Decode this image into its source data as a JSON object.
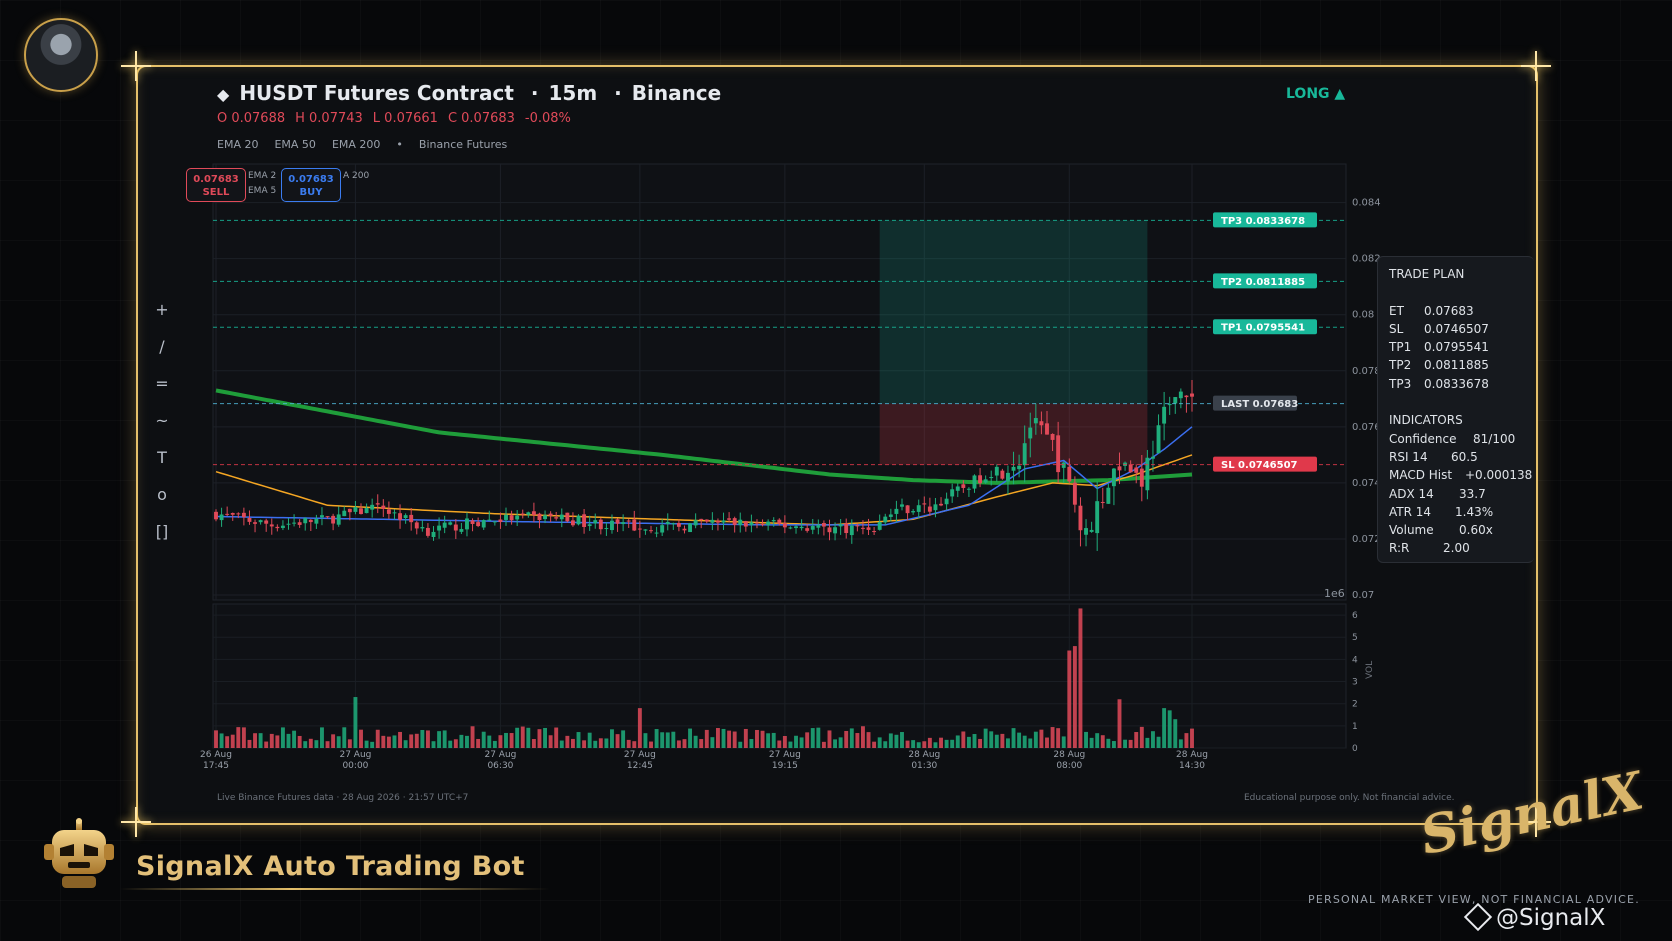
{
  "header": {
    "title": "HUSDT Futures Contract",
    "timeframe": "15m",
    "exchange": "Binance",
    "separator": "·",
    "direction": "LONG ▲"
  },
  "ohlc": {
    "o": "O 0.07688",
    "h": "H 0.07743",
    "l": "L 0.07661",
    "c": "C 0.07683",
    "change": "-0.08%"
  },
  "legend": {
    "ema20": "EMA 20",
    "ema50": "EMA 50",
    "ema200": "EMA 200",
    "dot": "•",
    "source": "Binance Futures"
  },
  "mini_legend": {
    "a": "EMA 2",
    "b": "EMA 5",
    "c": "A 200"
  },
  "sell_box": {
    "price": "0.07683",
    "label": "SELL"
  },
  "buy_box": {
    "price": "0.07683",
    "label": "BUY"
  },
  "tools": [
    "+",
    "/",
    "=",
    "~",
    "T",
    "o",
    "[]"
  ],
  "trade_panel": {
    "title": "TRADE PLAN",
    "rows": [
      {
        "k": "ET",
        "v": "0.07683"
      },
      {
        "k": "SL",
        "v": "0.0746507"
      },
      {
        "k": "TP1",
        "v": "0.0795541"
      },
      {
        "k": "TP2",
        "v": "0.0811885"
      },
      {
        "k": "TP3",
        "v": "0.0833678"
      }
    ],
    "indicators_title": "INDICATORS",
    "indicators": [
      {
        "k": "Confidence",
        "v": "81/100"
      },
      {
        "k": "RSI 14",
        "v": "60.5"
      },
      {
        "k": "MACD Hist",
        "v": "+0.000138"
      },
      {
        "k": "ADX 14",
        "v": "33.7"
      },
      {
        "k": "ATR 14",
        "v": "1.43%"
      },
      {
        "k": "Volume",
        "v": "0.60x"
      },
      {
        "k": "R:R",
        "v": "2.00"
      }
    ]
  },
  "footer": {
    "left": "Live Binance Futures data  ·  28 Aug 2026 · 21:57 UTC+7",
    "right": "Educational purpose only. Not financial advice."
  },
  "branding": {
    "bot_title": "SignalX Auto Trading Bot",
    "logo": "SignalX",
    "tagline": "PERSONAL MARKET VIEW, NOT FINANCIAL ADVICE.",
    "handle": "@SignalX"
  },
  "colors": {
    "up": "#1fae7c",
    "down": "#e04a59",
    "ema20": "#3b6ff0",
    "ema50": "#f5a623",
    "ema200": "#1f9d3a",
    "tp": "#18b89a",
    "sl": "#e0394b",
    "last": "#4fb6d8",
    "frame": "#e5c06a"
  },
  "chart_data": {
    "type": "candlestick",
    "price_axis": {
      "ticks": [
        "0.07",
        "0.072",
        "0.074",
        "0.076",
        "0.078",
        "0.08",
        "0.082",
        "0.084"
      ],
      "ylim": [
        0.07,
        0.0852
      ],
      "exponent_label": "1e6"
    },
    "volume_axis": {
      "ticks": [
        "0",
        "1",
        "2",
        "3",
        "4",
        "5",
        "6"
      ],
      "label": "VOL",
      "ylim": [
        0,
        6.5
      ]
    },
    "x_ticks": [
      {
        "label": "26 Aug\n17:45",
        "i": 0
      },
      {
        "label": "27 Aug\n00:00",
        "i": 25
      },
      {
        "label": "27 Aug\n06:30",
        "i": 51
      },
      {
        "label": "27 Aug\n12:45",
        "i": 76
      },
      {
        "label": "27 Aug\n19:15",
        "i": 102
      },
      {
        "label": "28 Aug\n01:30",
        "i": 127
      },
      {
        "label": "28 Aug\n08:00",
        "i": 153
      },
      {
        "label": "28 Aug\n14:30",
        "i": 175
      }
    ],
    "levels": [
      {
        "name": "TP3",
        "label": "TP3  0.0833678",
        "value": 0.0833678
      },
      {
        "name": "TP2",
        "label": "TP2  0.0811885",
        "value": 0.0811885
      },
      {
        "name": "TP1",
        "label": "TP1  0.0795541",
        "value": 0.0795541
      },
      {
        "name": "LAST",
        "label": "LAST  0.07683",
        "value": 0.07683
      },
      {
        "name": "SL",
        "label": "SL  0.0746507",
        "value": 0.0746507
      }
    ],
    "position": {
      "entry": 0.07683,
      "sl": 0.0746507,
      "tp": 0.0833678,
      "start_i": 119,
      "end_i": 167
    },
    "candle_count": 176,
    "anchors": [
      [
        0,
        0.0729
      ],
      [
        10,
        0.0725
      ],
      [
        20,
        0.0727
      ],
      [
        26,
        0.073
      ],
      [
        30,
        0.0731
      ],
      [
        38,
        0.0723
      ],
      [
        50,
        0.0727
      ],
      [
        60,
        0.0728
      ],
      [
        70,
        0.0725
      ],
      [
        80,
        0.0724
      ],
      [
        90,
        0.0726
      ],
      [
        100,
        0.0725
      ],
      [
        110,
        0.0724
      ],
      [
        118,
        0.0724
      ],
      [
        122,
        0.0731
      ],
      [
        128,
        0.0731
      ],
      [
        132,
        0.0736
      ],
      [
        138,
        0.0743
      ],
      [
        144,
        0.0749
      ],
      [
        146,
        0.0761
      ],
      [
        150,
        0.0753
      ],
      [
        154,
        0.0734
      ],
      [
        156,
        0.0721
      ],
      [
        158,
        0.0732
      ],
      [
        162,
        0.0748
      ],
      [
        166,
        0.0742
      ],
      [
        170,
        0.0763
      ],
      [
        172,
        0.0775
      ],
      [
        175,
        0.0768
      ]
    ],
    "ema20": [
      [
        0,
        0.0728
      ],
      [
        30,
        0.0727
      ],
      [
        60,
        0.0726
      ],
      [
        100,
        0.0725
      ],
      [
        120,
        0.0725
      ],
      [
        135,
        0.0732
      ],
      [
        145,
        0.0745
      ],
      [
        152,
        0.0748
      ],
      [
        158,
        0.0738
      ],
      [
        165,
        0.0745
      ],
      [
        170,
        0.0752
      ],
      [
        175,
        0.076
      ]
    ],
    "ema50": [
      [
        0,
        0.0744
      ],
      [
        20,
        0.0732
      ],
      [
        50,
        0.0729
      ],
      [
        80,
        0.0727
      ],
      [
        110,
        0.0725
      ],
      [
        125,
        0.0727
      ],
      [
        140,
        0.0735
      ],
      [
        150,
        0.074
      ],
      [
        158,
        0.0739
      ],
      [
        165,
        0.0743
      ],
      [
        175,
        0.075
      ]
    ],
    "ema200": [
      [
        0,
        0.0773
      ],
      [
        40,
        0.0758
      ],
      [
        80,
        0.075
      ],
      [
        110,
        0.0743
      ],
      [
        125,
        0.0741
      ],
      [
        140,
        0.074
      ],
      [
        160,
        0.0741
      ],
      [
        175,
        0.0743
      ]
    ],
    "volume_spikes": [
      [
        25,
        2.3
      ],
      [
        76,
        1.8
      ],
      [
        153,
        4.4
      ],
      [
        154,
        4.6
      ],
      [
        155,
        6.3
      ],
      [
        162,
        2.2
      ],
      [
        170,
        1.8
      ],
      [
        171,
        1.7
      ],
      [
        172,
        1.3
      ]
    ]
  }
}
